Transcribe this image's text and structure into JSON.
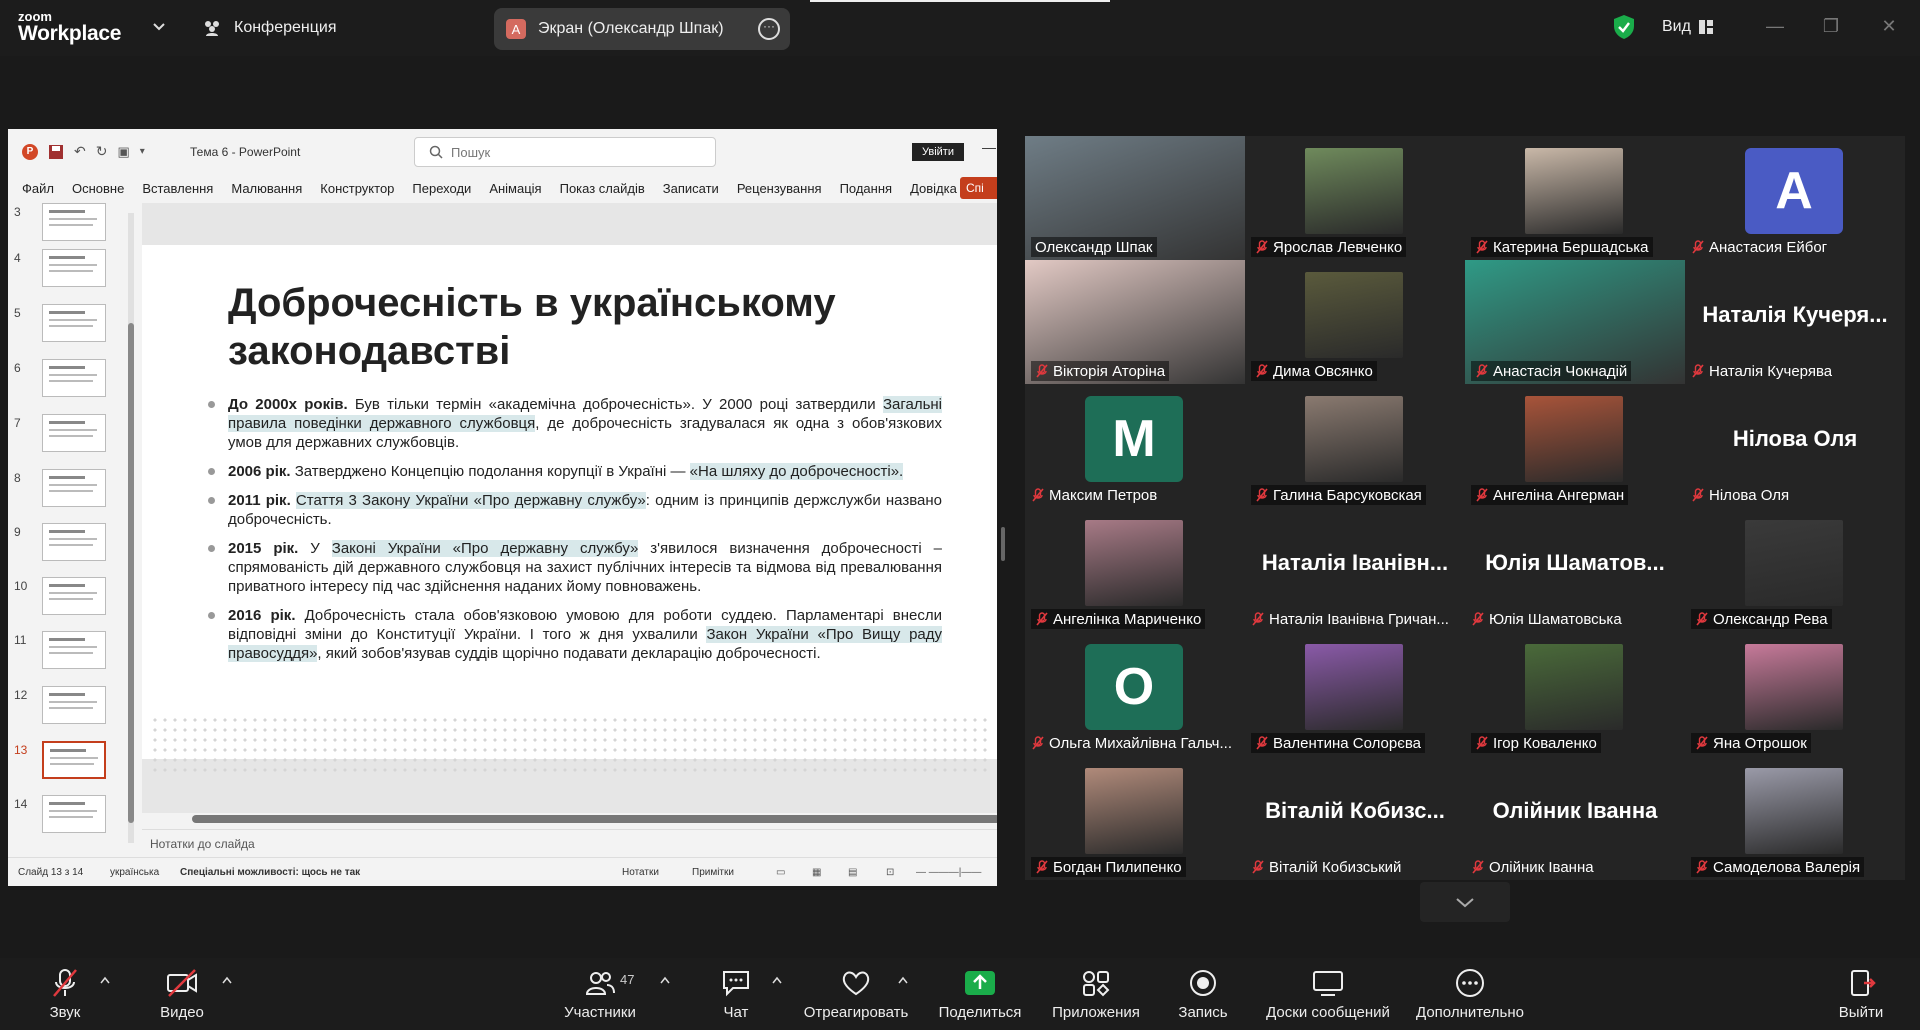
{
  "colors": {
    "accent_green": "#3adc6e",
    "danger": "#e0393e",
    "share_green": "#1aac4a",
    "ppt_orange": "#c43e1c"
  },
  "topbar": {
    "logo_line1": "zoom",
    "logo_line2": "Workplace",
    "meeting_label": "Конференция",
    "share_title": "Экран (Олександр Шпак)",
    "share_avatar_letter": "A",
    "view_label": "Вид"
  },
  "ppt": {
    "doc_title": "Тема 6  -  PowerPoint",
    "search_placeholder": "Пошук",
    "signin": "Увійти",
    "share_btn": "Спі",
    "menu": [
      "Файл",
      "Основне",
      "Вставлення",
      "Малювання",
      "Конструктор",
      "Переходи",
      "Анімація",
      "Показ слайдів",
      "Записати",
      "Рецензування",
      "Подання",
      "Довідка"
    ],
    "thumbnails": [
      "3",
      "4",
      "5",
      "6",
      "7",
      "8",
      "9",
      "10",
      "11",
      "12",
      "13",
      "14"
    ],
    "selected_thumbnail": "13",
    "slide": {
      "title": "Доброчесність в українському законодавстві",
      "bullets": [
        {
          "bold": "До 2000х років.",
          "text1": " Був тільки термін «академічна доброчесність». У 2000 році затвердили ",
          "hl": "Загальні правила поведінки державного службовця",
          "text2": ", де доброчесність згадувалася як одна з обов'язкових умов для державних службовців."
        },
        {
          "bold": "2006 рік.",
          "text1": " Затверджено Концепцію подолання корупції в Україні — ",
          "hl": "«На шляху до доброчесності».",
          "text2": ""
        },
        {
          "bold": "2011 рік.",
          "text1": " ",
          "hl": "Стаття 3 Закону України «Про державну службу»",
          "text2": ": одним із принципів держслужби названо доброчесність."
        },
        {
          "bold": "2015 рік.",
          "text1": " У ",
          "hl": "Законі України «Про державну службу»",
          "text2": " з'явилося визначення доброчесності – спрямованість дій державного службовця на захист публічних інтересів та відмова від превалювання приватного інтересу під час здійснення наданих йому повноважень."
        },
        {
          "bold": "2016 рік.",
          "text1": " Доброчесність стала обов'язковою умовою для роботи суддею. Парламентарі внесли відповідні зміни до Конституції України. І того ж дня ухвалили ",
          "hl": "Закон України «Про Вищу раду правосуддя»",
          "text2": ", який зобов'язував суддів щорічно подавати декларацію доброчесності."
        }
      ]
    },
    "notes_placeholder": "Нотатки до слайда",
    "status": {
      "slide_counter": "Слайд 13 з 14",
      "language": "українська",
      "accessibility": "Спеціальні можливості: щось не так",
      "notes": "Нотатки",
      "comments": "Примітки"
    }
  },
  "participants": [
    {
      "name": "Олександр Шпак",
      "type": "video",
      "speaking": true,
      "muted": false,
      "bg": "#6f7d86"
    },
    {
      "name": "Ярослав Левченко",
      "type": "photo",
      "muted": true,
      "bg": "#6f8a5c"
    },
    {
      "name": "Катерина Бершадська",
      "type": "photo",
      "muted": true,
      "bg": "#c9b8a8"
    },
    {
      "name": "Анастасия Ейбог",
      "type": "letter",
      "letter": "A",
      "muted": true,
      "bg": "#4a5bc4"
    },
    {
      "name": "Вікторія Аторіна",
      "type": "video",
      "muted": true,
      "bg": "#e2c9c4"
    },
    {
      "name": "Дима Овсянко",
      "type": "photo",
      "muted": true,
      "bg": "#5a5a3c"
    },
    {
      "name": "Анастасія Чокнадій",
      "type": "video",
      "muted": true,
      "bg": "#2f9a86"
    },
    {
      "name": "Наталія Кучерява",
      "big": "Наталія  Кучеря...",
      "type": "name",
      "muted": true
    },
    {
      "name": "Максим Петров",
      "type": "letter",
      "letter": "M",
      "muted": true,
      "bg": "#1e6e57"
    },
    {
      "name": "Галина Барсуковская",
      "type": "photo",
      "muted": true,
      "bg": "#8a7a70"
    },
    {
      "name": "Ангеліна Ангерман",
      "type": "photo",
      "muted": true,
      "bg": "#a8543a"
    },
    {
      "name": "Нілова Оля",
      "big": "Нілова Оля",
      "type": "name",
      "muted": true
    },
    {
      "name": "Ангелінка Мариченко",
      "type": "photo",
      "muted": true,
      "bg": "#a77a86"
    },
    {
      "name": "Наталія Іванівна Гричан...",
      "big": "Наталія Іванівн...",
      "type": "name",
      "muted": true
    },
    {
      "name": "Юлія Шаматовська",
      "big": "Юлія  Шаматов...",
      "type": "name",
      "muted": true
    },
    {
      "name": "Олександр Рева",
      "type": "photo",
      "muted": true,
      "bg": "#3a3a3a"
    },
    {
      "name": "Ольга Михайлівна Гальч...",
      "type": "letter",
      "letter": "О",
      "muted": true,
      "bg": "#1e6e57"
    },
    {
      "name": "Валентина Солорєва",
      "type": "photo",
      "muted": true,
      "bg": "#8a5aa8"
    },
    {
      "name": "Ігор Коваленко",
      "type": "photo",
      "muted": true,
      "bg": "#4a6a3a"
    },
    {
      "name": "Яна Отрошок",
      "type": "photo",
      "muted": true,
      "bg": "#c77a9a"
    },
    {
      "name": "Богдан Пилипенко",
      "type": "photo",
      "muted": true,
      "bg": "#b08a7a"
    },
    {
      "name": "Віталій Кобизський",
      "big": "Віталій  Кобизс...",
      "type": "name",
      "muted": true
    },
    {
      "name": "Олійник Іванна",
      "big": "Олійник Іванна",
      "type": "name",
      "muted": true
    },
    {
      "name": "Самоделова Валерія",
      "type": "photo",
      "muted": true,
      "bg": "#9a9aa8"
    }
  ],
  "toolbar": {
    "audio": "Звук",
    "video": "Видео",
    "participants": "Участники",
    "participants_count": "47",
    "chat": "Чат",
    "react": "Отреагировать",
    "share": "Поделиться",
    "apps": "Приложения",
    "record": "Запись",
    "whiteboards": "Доски сообщений",
    "more": "Дополнительно",
    "leave": "Выйти"
  }
}
